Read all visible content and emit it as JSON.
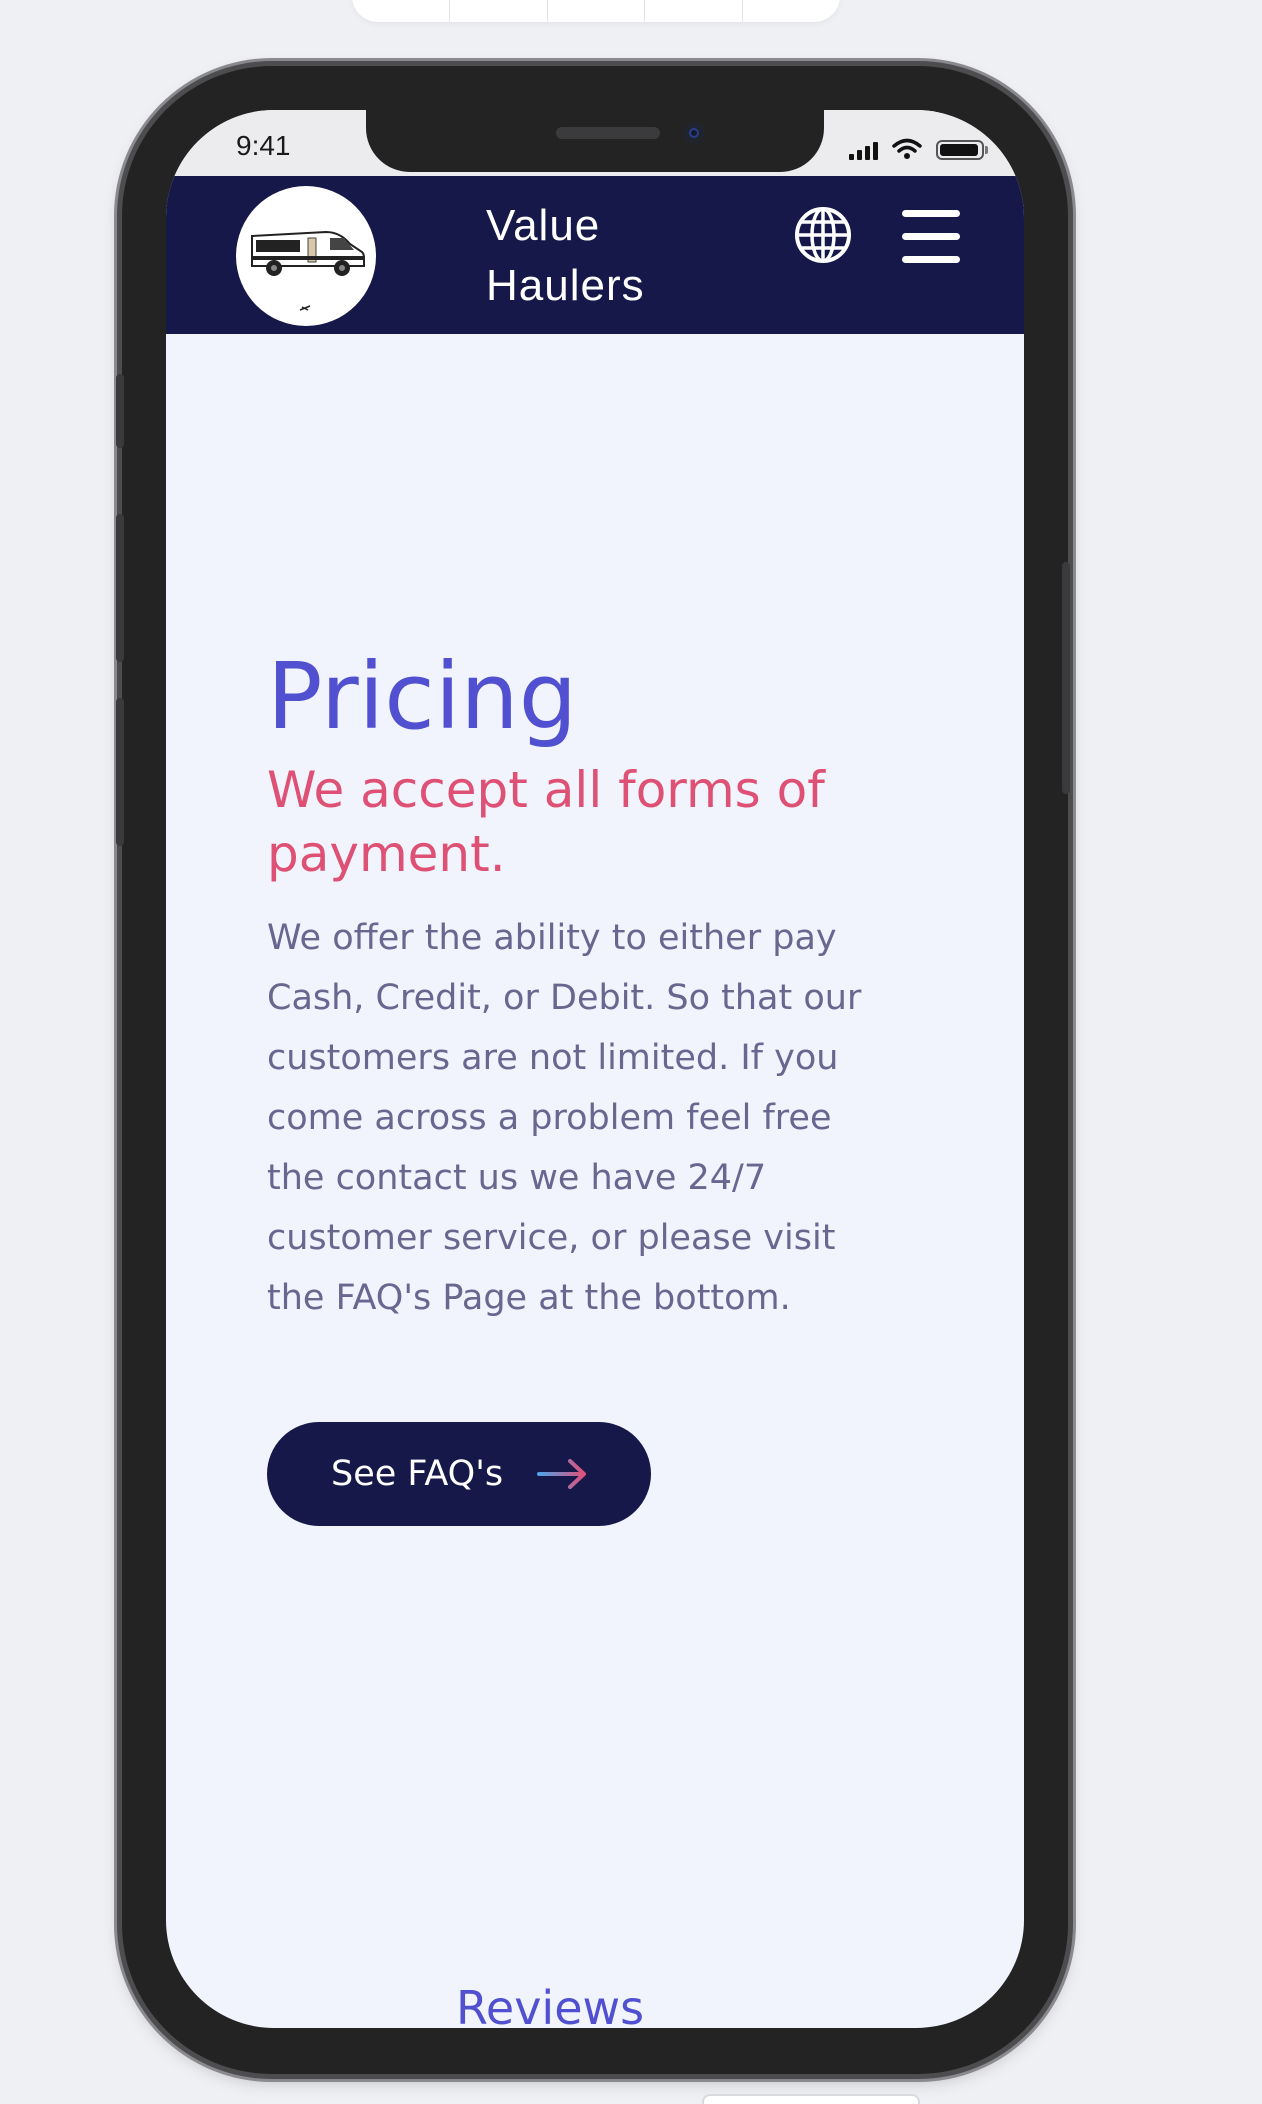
{
  "status_bar": {
    "time": "9:41"
  },
  "header": {
    "brand": "Value\nHaulers",
    "logo_icon": "van-logo-icon",
    "language_icon": "globe-icon",
    "menu_icon": "hamburger-menu-icon"
  },
  "main": {
    "title": "Pricing",
    "subtitle": "We accept all forms of payment.",
    "body": "We offer the ability to either pay Cash, Credit, or Debit. So that our customers are not limited. If you come across a problem feel free the contact us we have 24/7 customer service, or please visit the FAQ's Page at the bottom.",
    "cta_label": "See FAQ's",
    "cta_icon": "arrow-right-icon"
  },
  "next_section": {
    "title": "Reviews"
  },
  "colors": {
    "navy": "#16184a",
    "title_purple": "#5150d0",
    "subtitle_pink": "#de5175",
    "body_text": "#6a6690",
    "screen_bg": "#f1f4fc",
    "arrow_blue": "#4fa3e8",
    "arrow_pink": "#e0507a"
  }
}
